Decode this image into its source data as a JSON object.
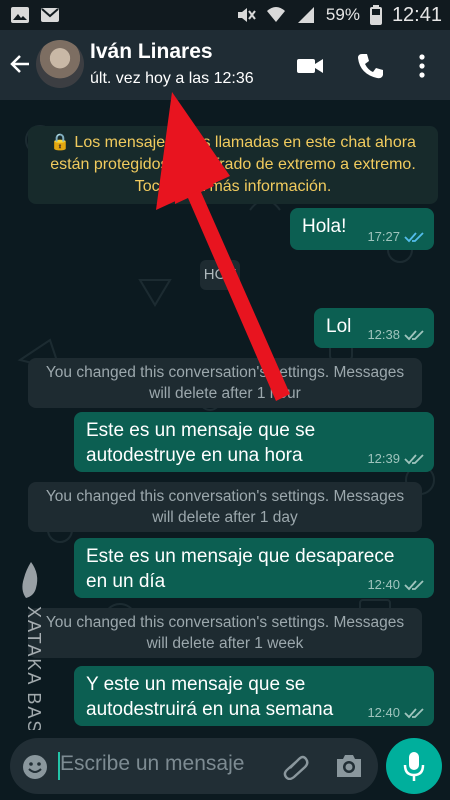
{
  "status_bar": {
    "battery_percent": "59%",
    "time": "12:41"
  },
  "header": {
    "contact_name": "Iván Linares",
    "last_seen": "últ. vez hoy a las 12:36"
  },
  "encryption_notice": {
    "line1": "🔒 Los mensajes y las llamadas en este chat ahora",
    "line2": "están protegidos con cifrado de extremo a extremo.",
    "line3": "Toca para más información."
  },
  "date_chip": "HOY",
  "messages": [
    {
      "type": "out",
      "lines": [
        "Hola!"
      ],
      "time": "17:27",
      "read": true
    },
    {
      "type": "out",
      "lines": [
        "Lol"
      ],
      "time": "12:38",
      "read": false
    },
    {
      "type": "system",
      "lines": [
        "You changed this conversation's settings. Messages",
        "will delete after 1 hour"
      ]
    },
    {
      "type": "out",
      "lines": [
        "Este es un mensaje que se",
        "autodestruye en una hora"
      ],
      "time": "12:39",
      "read": false
    },
    {
      "type": "system",
      "lines": [
        "You changed this conversation's settings. Messages",
        "will delete after 1 day"
      ]
    },
    {
      "type": "out",
      "lines": [
        "Este es un mensaje que desaparece",
        "en un día"
      ],
      "time": "12:40",
      "read": false
    },
    {
      "type": "system",
      "lines": [
        "You changed this conversation's settings. Messages",
        "will delete after 1 week"
      ]
    },
    {
      "type": "out",
      "lines": [
        "Y este un mensaje que se",
        "autodestruirá en una semana"
      ],
      "time": "12:40",
      "read": false
    }
  ],
  "composer": {
    "placeholder": "Escribe un mensaje"
  },
  "watermark": "XATAKA BASICS",
  "colors": {
    "header": "#1f2c34",
    "outgoing_bubble": "#0c5f52",
    "system_bubble": "#1e2b31",
    "notice_text": "#f1cb5e",
    "mic_button": "#00af9c",
    "arrow": "#e8141f",
    "read_ticks": "#53bdeb"
  },
  "icons": [
    "gallery-icon",
    "gmail-icon",
    "mute-icon",
    "wifi-icon",
    "signal-icon",
    "battery-icon",
    "back-arrow-icon",
    "video-call-icon",
    "phone-icon",
    "more-vert-icon",
    "emoji-icon",
    "attach-icon",
    "camera-icon",
    "mic-icon"
  ]
}
